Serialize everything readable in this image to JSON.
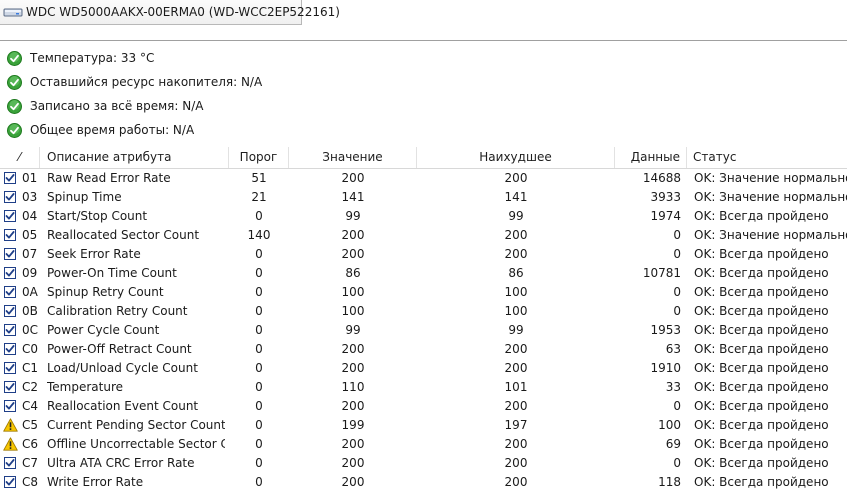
{
  "tab": {
    "title": "WDC WD5000AAKX-00ERMA0 (WD-WCC2EP522161)"
  },
  "summary": [
    {
      "text": "Температура: 33 °C",
      "icon": "ok-check-icon"
    },
    {
      "text": "Оставшийся ресурс накопителя: N/A",
      "icon": "ok-check-icon"
    },
    {
      "text": "Записано за всё время: N/A",
      "icon": "ok-check-icon"
    },
    {
      "text": "Общее время работы: N/A",
      "icon": "ok-check-icon"
    }
  ],
  "table": {
    "headers": {
      "sort": "⁄",
      "description": "Описание атрибута",
      "threshold": "Порог",
      "value": "Значение",
      "worst": "Наихудшее",
      "data": "Данные",
      "status": "Статус"
    },
    "rows": [
      {
        "icon": "checkbox",
        "id": "01",
        "name": "Raw Read Error Rate",
        "threshold": "51",
        "value": "200",
        "worst": "200",
        "data": "14688",
        "status": "OK: Значение нормальное"
      },
      {
        "icon": "checkbox",
        "id": "03",
        "name": "Spinup Time",
        "threshold": "21",
        "value": "141",
        "worst": "141",
        "data": "3933",
        "status": "OK: Значение нормальное"
      },
      {
        "icon": "checkbox",
        "id": "04",
        "name": "Start/Stop Count",
        "threshold": "0",
        "value": "99",
        "worst": "99",
        "data": "1974",
        "status": "OK: Всегда пройдено"
      },
      {
        "icon": "checkbox",
        "id": "05",
        "name": "Reallocated Sector Count",
        "threshold": "140",
        "value": "200",
        "worst": "200",
        "data": "0",
        "status": "OK: Значение нормальное"
      },
      {
        "icon": "checkbox",
        "id": "07",
        "name": "Seek Error Rate",
        "threshold": "0",
        "value": "200",
        "worst": "200",
        "data": "0",
        "status": "OK: Всегда пройдено"
      },
      {
        "icon": "checkbox",
        "id": "09",
        "name": "Power-On Time Count",
        "threshold": "0",
        "value": "86",
        "worst": "86",
        "data": "10781",
        "status": "OK: Всегда пройдено"
      },
      {
        "icon": "checkbox",
        "id": "0A",
        "name": "Spinup Retry Count",
        "threshold": "0",
        "value": "100",
        "worst": "100",
        "data": "0",
        "status": "OK: Всегда пройдено"
      },
      {
        "icon": "checkbox",
        "id": "0B",
        "name": "Calibration Retry Count",
        "threshold": "0",
        "value": "100",
        "worst": "100",
        "data": "0",
        "status": "OK: Всегда пройдено"
      },
      {
        "icon": "checkbox",
        "id": "0C",
        "name": "Power Cycle Count",
        "threshold": "0",
        "value": "99",
        "worst": "99",
        "data": "1953",
        "status": "OK: Всегда пройдено"
      },
      {
        "icon": "checkbox",
        "id": "C0",
        "name": "Power-Off Retract Count",
        "threshold": "0",
        "value": "200",
        "worst": "200",
        "data": "63",
        "status": "OK: Всегда пройдено"
      },
      {
        "icon": "checkbox",
        "id": "C1",
        "name": "Load/Unload Cycle Count",
        "threshold": "0",
        "value": "200",
        "worst": "200",
        "data": "1910",
        "status": "OK: Всегда пройдено"
      },
      {
        "icon": "checkbox",
        "id": "C2",
        "name": "Temperature",
        "threshold": "0",
        "value": "110",
        "worst": "101",
        "data": "33",
        "status": "OK: Всегда пройдено"
      },
      {
        "icon": "checkbox",
        "id": "C4",
        "name": "Reallocation Event Count",
        "threshold": "0",
        "value": "200",
        "worst": "200",
        "data": "0",
        "status": "OK: Всегда пройдено"
      },
      {
        "icon": "warning",
        "id": "C5",
        "name": "Current Pending Sector Count",
        "threshold": "0",
        "value": "199",
        "worst": "197",
        "data": "100",
        "status": "OK: Всегда пройдено"
      },
      {
        "icon": "warning",
        "id": "C6",
        "name": "Offline Uncorrectable Sector C...",
        "threshold": "0",
        "value": "200",
        "worst": "200",
        "data": "69",
        "status": "OK: Всегда пройдено"
      },
      {
        "icon": "checkbox",
        "id": "C7",
        "name": "Ultra ATA CRC Error Rate",
        "threshold": "0",
        "value": "200",
        "worst": "200",
        "data": "0",
        "status": "OK: Всегда пройдено"
      },
      {
        "icon": "checkbox",
        "id": "C8",
        "name": "Write Error Rate",
        "threshold": "0",
        "value": "200",
        "worst": "200",
        "data": "118",
        "status": "OK: Всегда пройдено"
      }
    ]
  }
}
